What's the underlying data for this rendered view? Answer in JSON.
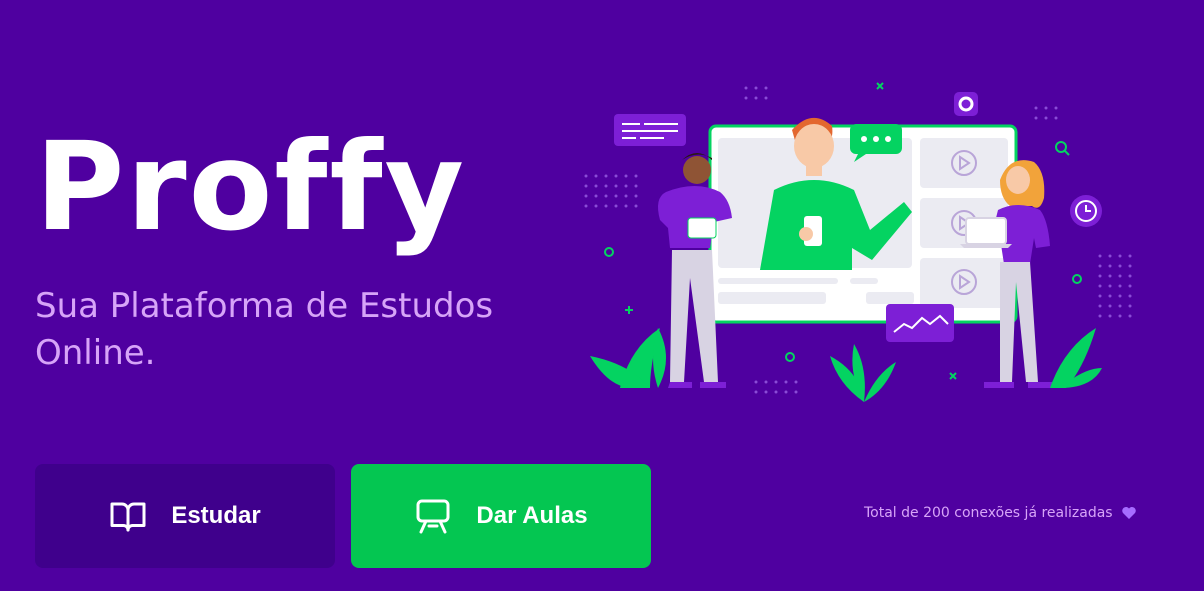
{
  "brand": {
    "logo_text": "Proffy"
  },
  "tagline": "Sua Plataforma de Estudos Online.",
  "actions": {
    "study": {
      "label": "Estudar",
      "icon": "book-open-icon"
    },
    "teach": {
      "label": "Dar Aulas",
      "icon": "presentation-icon"
    }
  },
  "footer": {
    "connections_text": "Total de 200 conexões já realizadas",
    "connections_icon": "heart-icon"
  },
  "colors": {
    "background": "#4f00a0",
    "tagline": "#d7a4f8",
    "study_button": "#3f008c",
    "teach_button": "#04c651",
    "heart": "#a66cff"
  }
}
